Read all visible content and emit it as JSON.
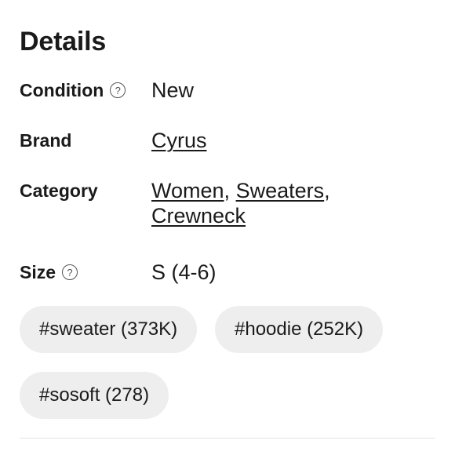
{
  "section": {
    "title": "Details"
  },
  "details": {
    "condition": {
      "label": "Condition",
      "value": "New",
      "help_icon": "question-circle-icon"
    },
    "brand": {
      "label": "Brand",
      "value": "Cyrus"
    },
    "category": {
      "label": "Category",
      "links": [
        "Women",
        "Sweaters",
        "Crewneck"
      ]
    },
    "size": {
      "label": "Size",
      "value": "S (4-6)",
      "help_icon": "question-circle-icon"
    }
  },
  "tags": [
    "#sweater (373K)",
    "#hoodie (252K)",
    "#sosoft (278)"
  ],
  "colors": {
    "text": "#1a1a1a",
    "tag_background": "#eeeeef",
    "divider": "#e3e3e3"
  }
}
